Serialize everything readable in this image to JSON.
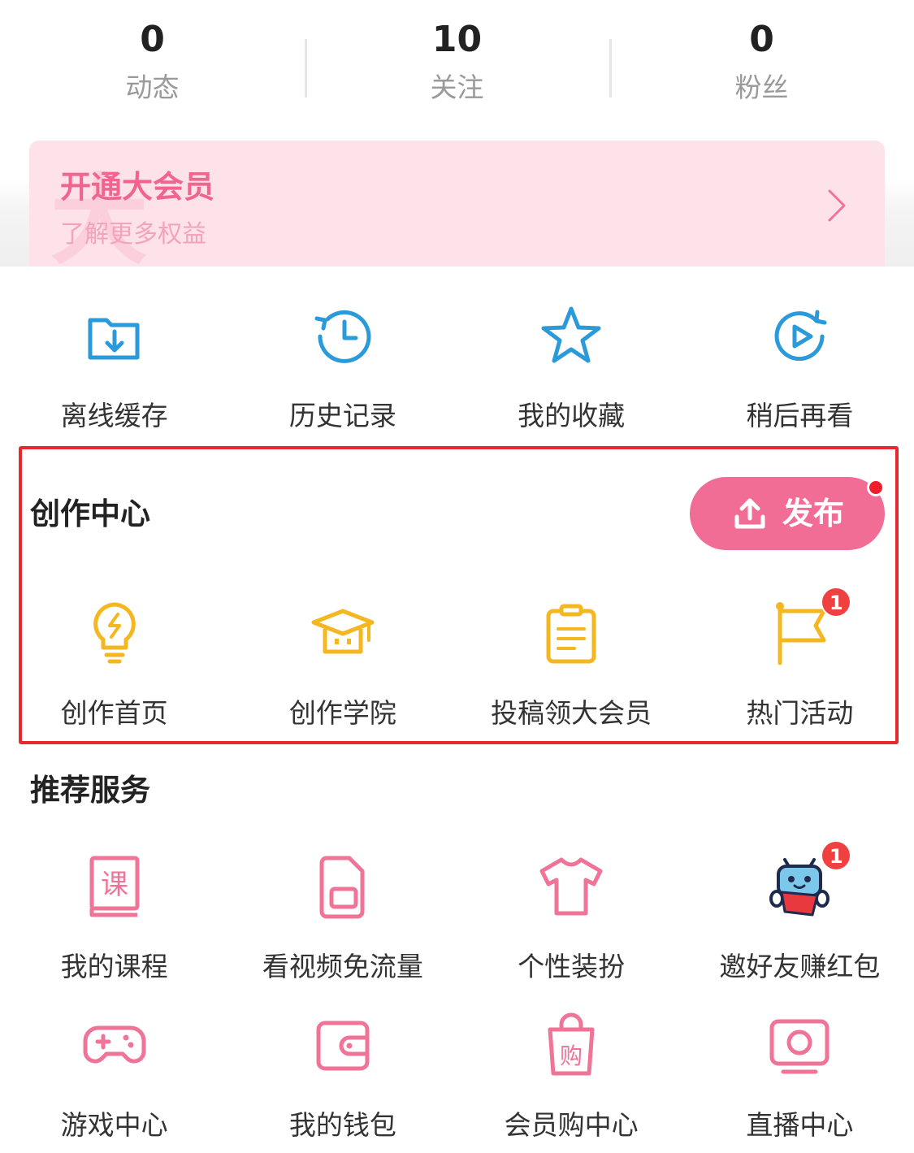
{
  "stats": [
    {
      "value": "0",
      "label": "动态"
    },
    {
      "value": "10",
      "label": "关注"
    },
    {
      "value": "0",
      "label": "粉丝"
    }
  ],
  "vip_banner": {
    "title": "开通大会员",
    "subtitle": "了解更多权益",
    "watermark": "大",
    "icon": "chevron-right-icon"
  },
  "quick_actions": [
    {
      "label": "离线缓存",
      "icon": "download-folder-icon"
    },
    {
      "label": "历史记录",
      "icon": "history-clock-icon"
    },
    {
      "label": "我的收藏",
      "icon": "star-icon"
    },
    {
      "label": "稍后再看",
      "icon": "play-later-icon"
    }
  ],
  "creator_center": {
    "title": "创作中心",
    "publish_label": "发布",
    "publish_icon": "upload-icon",
    "items": [
      {
        "label": "创作首页",
        "icon": "lightbulb-icon"
      },
      {
        "label": "创作学院",
        "icon": "graduation-cap-icon"
      },
      {
        "label": "投稿领大会员",
        "icon": "clipboard-icon"
      },
      {
        "label": "热门活动",
        "icon": "flag-icon",
        "badge": "1"
      }
    ]
  },
  "recommended": {
    "title": "推荐服务",
    "items": [
      {
        "label": "我的课程",
        "icon": "course-book-icon",
        "icon_text": "课"
      },
      {
        "label": "看视频免流量",
        "icon": "sim-card-icon"
      },
      {
        "label": "个性装扮",
        "icon": "tshirt-icon"
      },
      {
        "label": "邀好友赚红包",
        "icon": "mascot-red-envelope-icon",
        "badge": "1"
      },
      {
        "label": "游戏中心",
        "icon": "gamepad-icon"
      },
      {
        "label": "我的钱包",
        "icon": "wallet-icon"
      },
      {
        "label": "会员购中心",
        "icon": "shopping-bag-icon",
        "icon_text": "购"
      },
      {
        "label": "直播中心",
        "icon": "live-tv-icon"
      }
    ]
  },
  "colors": {
    "accent_pink": "#f26d95",
    "blue_icon": "#2b9ad9",
    "yellow_icon": "#f5b720",
    "pink_icon": "#f07497",
    "badge_red": "#f04141",
    "highlight_border": "#e8292c"
  }
}
